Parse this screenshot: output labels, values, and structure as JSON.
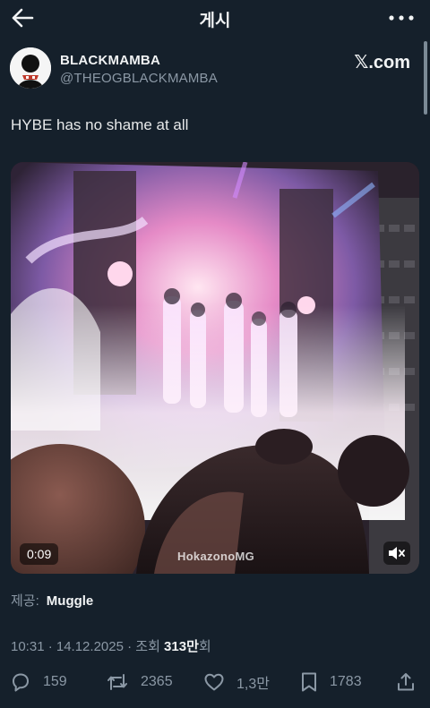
{
  "header": {
    "title": "게시",
    "back_icon": "arrow-left-icon",
    "more_icon": "more-dots-icon"
  },
  "author": {
    "display_name": "BLACKMAMBA",
    "handle": "@THEOGBLACKMAMBA",
    "source_logo": "𝕏.com"
  },
  "post": {
    "text": "HYBE has no shame at all"
  },
  "media": {
    "duration": "0:09",
    "watermark": "HokazonoMG",
    "mute_icon": "speaker-muted-icon"
  },
  "provider": {
    "label": "제공:",
    "name": "Muggle"
  },
  "meta": {
    "timestamp": "10:31 · 14.12.2025 · 조회 ",
    "views": "313만",
    "views_suffix": "회"
  },
  "actions": {
    "replies": "159",
    "reposts": "2365",
    "likes": "1,3만",
    "bookmarks": "1783"
  },
  "colors": {
    "background": "#15202b",
    "primary_text": "#e7e9ea",
    "secondary_text": "#8b98a5"
  }
}
